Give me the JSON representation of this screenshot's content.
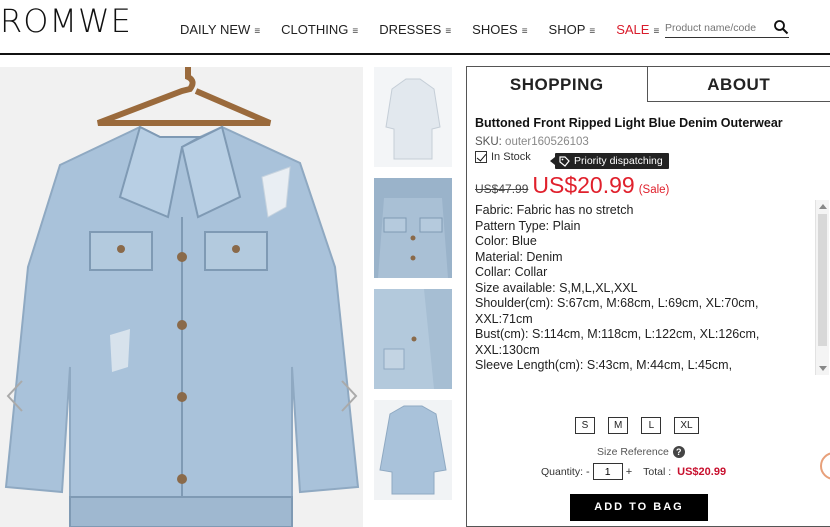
{
  "header": {
    "logo": "ROMWE",
    "nav": [
      {
        "label": "DAILY NEW",
        "icon": "menu-icon"
      },
      {
        "label": "CLOTHING",
        "icon": "menu-icon"
      },
      {
        "label": "DRESSES",
        "icon": "menu-icon"
      },
      {
        "label": "SHOES",
        "icon": "menu-icon"
      },
      {
        "label": "SHOP",
        "icon": "menu-icon"
      },
      {
        "label": "SALE",
        "icon": "menu-icon"
      }
    ],
    "search_placeholder": "Product name/code",
    "menu_glyph": "≡"
  },
  "tabs": {
    "shopping": "SHOPPING",
    "about": "ABOUT"
  },
  "product": {
    "title": "Buttoned Front Ripped Light Blue Denim Outerwear",
    "sku_label": "SKU:",
    "sku_value": "outer160526103",
    "stock": "In Stock",
    "dispatch": "Priority dispatching",
    "old_price": "US$47.99",
    "new_price": "US$20.99",
    "sale_tag": "(Sale)",
    "description": [
      "Fabric: Fabric has no stretch",
      "Pattern Type: Plain",
      "Color: Blue",
      "Material: Denim",
      "Collar: Collar",
      "Size available: S,M,L,XL,XXL",
      "Shoulder(cm): S:67cm, M:68cm, L:69cm, XL:70cm, XXL:71cm",
      "Bust(cm): S:114cm, M:118cm, L:122cm, XL:126cm, XXL:130cm",
      "Sleeve Length(cm): S:43cm, M:44cm, L:45cm,"
    ],
    "sizes": [
      "S",
      "M",
      "L",
      "XL"
    ],
    "size_reference": "Size Reference",
    "quantity_label": "Quantity:",
    "quantity_minus": "-",
    "quantity_value": "1",
    "quantity_plus": "+",
    "total_label": "Total :",
    "total_value": "US$20.99",
    "add_to_bag": "ADD TO BAG"
  },
  "colors": {
    "accent_red": "#e0202c",
    "denim": "#9fbbd4",
    "text": "#222222"
  }
}
